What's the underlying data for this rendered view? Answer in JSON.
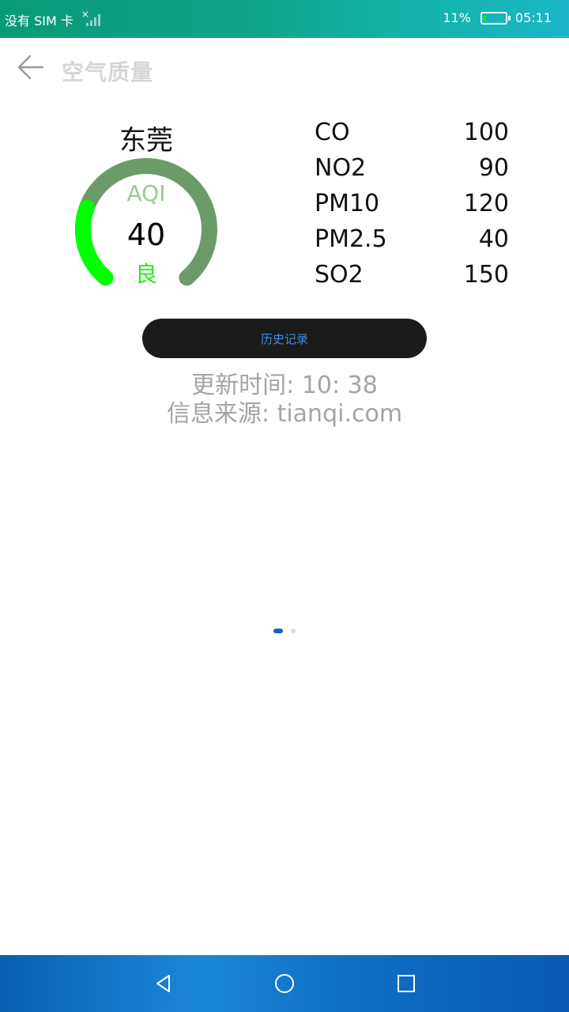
{
  "status_bar": {
    "carrier": "没有 SIM 卡",
    "battery_percent": "11%",
    "battery_level": 0.11,
    "time": "05:11"
  },
  "header": {
    "title": "空气质量"
  },
  "aqi_card": {
    "city": "东莞",
    "label": "AQI",
    "value": "40",
    "level": "良",
    "gauge_fraction": 0.25,
    "gauge_active_color": "#00ff00",
    "gauge_track_color": "#6b9b68"
  },
  "pollutants": [
    {
      "name": "CO",
      "value": "100"
    },
    {
      "name": "NO2",
      "value": "90"
    },
    {
      "name": "PM10",
      "value": "120"
    },
    {
      "name": "PM2.5",
      "value": "40"
    },
    {
      "name": "SO2",
      "value": "150"
    }
  ],
  "history_button": {
    "label": "历史记录"
  },
  "info": {
    "update_time": "更新时间: 10: 38",
    "source": "信息来源: tianqi.com"
  },
  "pager": {
    "current_page": 1,
    "total_pages": 2
  },
  "colors": {
    "accent": "#1a5fd6",
    "button_bg": "#1b1b1b",
    "button_text": "#3d8be8"
  }
}
